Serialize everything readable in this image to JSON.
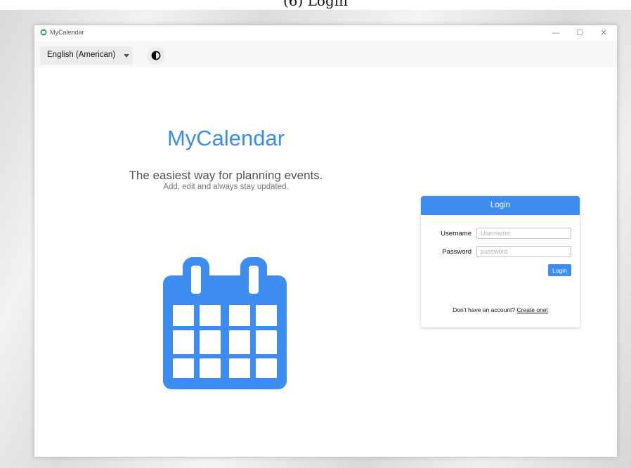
{
  "caption": "(6) Login",
  "window": {
    "title": "MyCalendar",
    "minimize_glyph": "—",
    "maximize_glyph": "☐",
    "close_glyph": "✕"
  },
  "toolbar": {
    "language_selected": "English (American)",
    "theme_icon": "contrast-icon"
  },
  "hero": {
    "title": "MyCalendar",
    "tagline": "The easiest way for planning events.",
    "subtagline": "Add, edit and always stay updated.",
    "illustration_icon": "calendar-icon"
  },
  "login": {
    "header": "Login",
    "username_label": "Username",
    "username_placeholder": "Username",
    "username_value": "",
    "password_label": "Password",
    "password_placeholder": "password",
    "password_value": "",
    "button_label": "Login",
    "signup_prompt": "Don't have an account?",
    "signup_link": "Create one!"
  },
  "colors": {
    "accent": "#3d8cf0",
    "toolbar_bg": "#f7f7f7",
    "card_bg": "#ffffff"
  }
}
